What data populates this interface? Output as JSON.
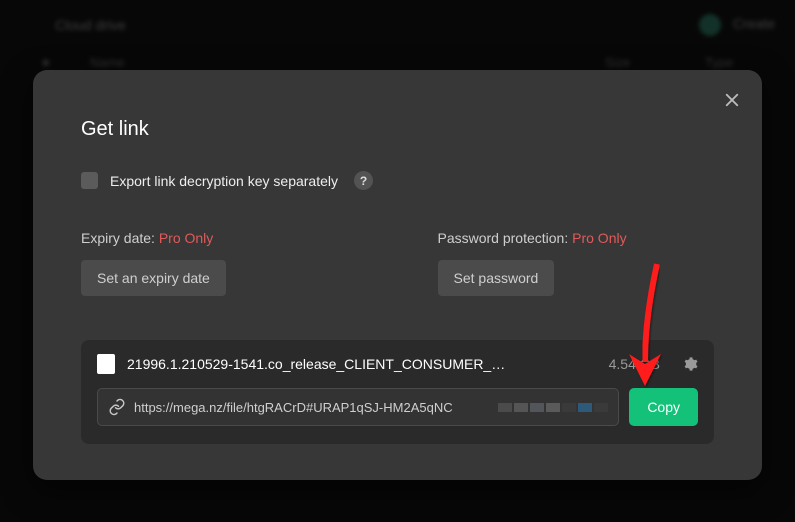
{
  "bg": {
    "title": "Cloud drive",
    "create": "Create",
    "col_name": "Name",
    "col_size": "Size",
    "col_type": "Type"
  },
  "modal": {
    "title": "Get link",
    "checkbox_label": "Export link decryption key separately",
    "help": "?",
    "expiry": {
      "label": "Expiry date:",
      "tag": "Pro Only",
      "button": "Set an expiry date"
    },
    "password": {
      "label": "Password protection:",
      "tag": "Pro Only",
      "button": "Set password"
    }
  },
  "file": {
    "name": "21996.1.210529-1541.co_release_CLIENT_CONSUMER_…",
    "size": "4.54 GB",
    "url": "https://mega.nz/file/htgRACrD#URAP1qSJ-HM2A5qNC",
    "copy": "Copy"
  }
}
